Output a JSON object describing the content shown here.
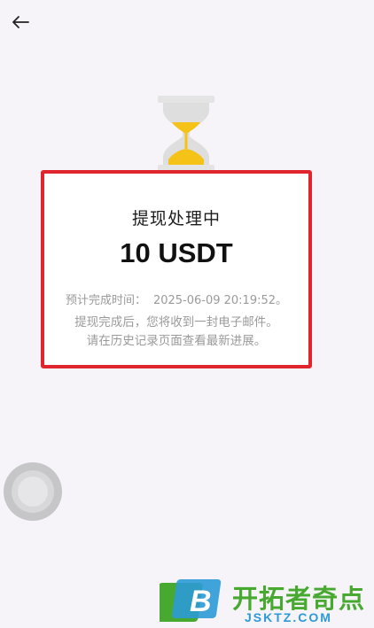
{
  "header": {
    "back_icon": "arrow-left-icon"
  },
  "illustration": {
    "icon": "hourglass-icon",
    "colors": {
      "sand": "#f5c217",
      "glass": "#d9d9d9"
    }
  },
  "status_card": {
    "border_color": "#e1252d",
    "title": "提现处理中",
    "amount": "10 USDT",
    "eta_label": "预计完成时间：",
    "eta_value": "2025-06-09 20:19:52",
    "eta_suffix": "。",
    "notice_line_1": "提现完成后，您将收到一封电子邮件。",
    "notice_line_2": "请在历史记录页面查看最新进展。"
  },
  "floating_button": {
    "icon": "assistive-touch-icon"
  },
  "watermark": {
    "logo_letter": "B",
    "title": "开拓者奇点",
    "domain": "JSKTZ.COM",
    "colors": {
      "green": "#47a92f",
      "blue": "#2c9ad6"
    }
  }
}
